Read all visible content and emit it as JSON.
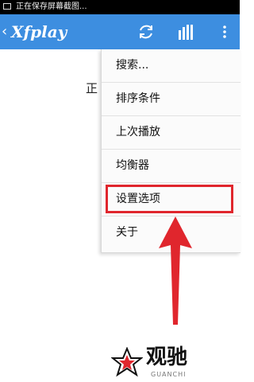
{
  "status_bar": {
    "text": "正在保存屏幕截图..."
  },
  "app_bar": {
    "title": "Xfplay",
    "icons": [
      "back-icon",
      "refresh-icon",
      "equalizer-bars-icon",
      "more-vert-icon"
    ]
  },
  "background": {
    "partial_text": "正"
  },
  "menu": {
    "items": [
      {
        "label": "搜索..."
      },
      {
        "label": "排序条件"
      },
      {
        "label": "上次播放"
      },
      {
        "label": "均衡器"
      },
      {
        "label": "设置选项"
      },
      {
        "label": "关于"
      }
    ],
    "highlighted_index": 4
  },
  "annotation": {
    "color": "#e0262d",
    "pointer": "up-arrow"
  },
  "watermark": {
    "brand": "观驰",
    "sub": "GUANCHI"
  },
  "colors": {
    "appbar": "#3d8ee0",
    "highlight": "#e0262d"
  }
}
